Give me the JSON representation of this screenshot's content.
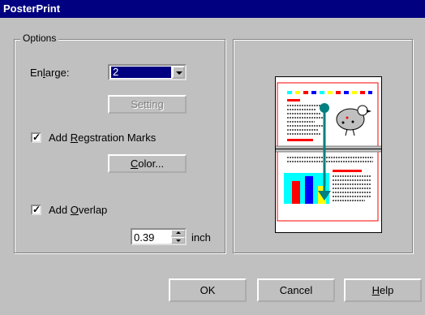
{
  "window": {
    "title": "PosterPrint"
  },
  "options": {
    "group_label": "Options",
    "enlarge_label_pre": "En",
    "enlarge_label_u": "l",
    "enlarge_label_post": "arge:",
    "enlarge_value": "2",
    "setting_button": "Setting",
    "registration_checked": true,
    "registration_label_pre": "Add ",
    "registration_label_u": "R",
    "registration_label_post": "egstration Marks",
    "color_button_u": "C",
    "color_button_post": "olor...",
    "overlap_checked": true,
    "overlap_label_pre": "Add ",
    "overlap_label_u": "O",
    "overlap_label_post": "verlap",
    "overlap_value": "0.39",
    "overlap_unit": "inch"
  },
  "buttons": {
    "ok": "OK",
    "cancel": "Cancel",
    "help_u": "H",
    "help_post": "elp"
  },
  "colors": {
    "titlebar": "#000080",
    "preview_accent": "#008080",
    "bar_red": "#ff0000",
    "bar_blue": "#0000ff",
    "bar_yellow": "#ffff00",
    "bar_cyan": "#00ffff"
  }
}
